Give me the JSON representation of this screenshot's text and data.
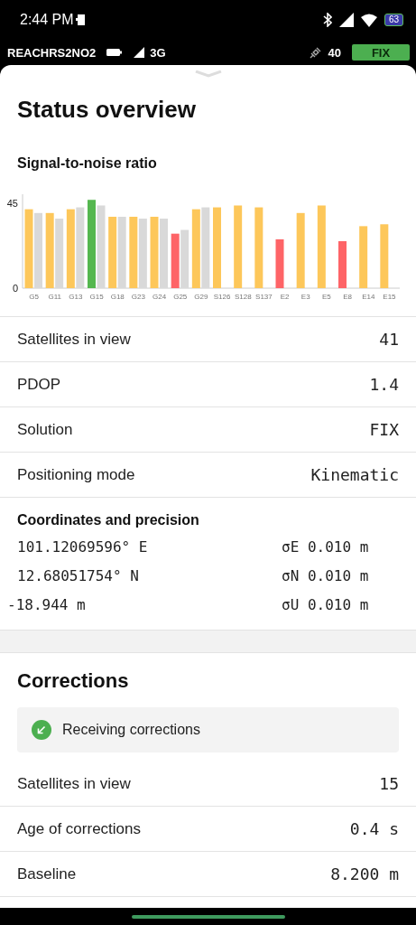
{
  "status_bar": {
    "time": "2:44 PM",
    "battery": "63"
  },
  "device_bar": {
    "name": "REACHRS2NO2",
    "network": "3G",
    "satellites": "40",
    "solution": "FIX"
  },
  "status_overview": {
    "title": "Status overview",
    "snr": {
      "title": "Signal-to-noise ratio",
      "chart_data": {
        "type": "bar",
        "categories": [
          "G5",
          "G11",
          "G13",
          "G15",
          "G18",
          "G23",
          "G24",
          "G25",
          "G29",
          "S126",
          "S128",
          "S137",
          "E2",
          "E3",
          "E5",
          "E8",
          "E14",
          "E15"
        ],
        "ylim": [
          0,
          50
        ],
        "yticks": [
          0,
          45
        ],
        "series": [
          {
            "colors": [
              "#fdc75a",
              "#fdc75a",
              "#fdc75a",
              "#55b74f",
              "#fdc75a",
              "#fdc75a",
              "#fdc75a",
              "#fe6467",
              "#fdc75a",
              "#fdc75a",
              "#fdc75a",
              "#fdc75a",
              "#fe6467",
              "#fdc75a",
              "#fdc75a",
              "#fe6467",
              "#fdc75a",
              "#fdc75a"
            ],
            "values": [
              42,
              40,
              42,
              47,
              38,
              38,
              38,
              29,
              42,
              43,
              44,
              43,
              26,
              40,
              44,
              25,
              33,
              34
            ]
          },
          {
            "color": "#d9d9d9",
            "values": [
              40,
              37,
              43,
              44,
              38,
              37,
              37,
              31,
              43,
              null,
              null,
              null,
              null,
              null,
              null,
              null,
              null,
              null
            ]
          }
        ]
      }
    },
    "rows": [
      {
        "label": "Satellites in view",
        "value": "41"
      },
      {
        "label": "PDOP",
        "value": "1.4"
      },
      {
        "label": "Solution",
        "value": "FIX"
      },
      {
        "label": "Positioning mode",
        "value": "Kinematic"
      }
    ],
    "coordinates": {
      "title": "Coordinates and precision",
      "lines": [
        {
          "value": "101.12069596° E",
          "precision": "σE 0.010 m"
        },
        {
          "value": "12.68051754° N",
          "precision": "σN 0.010 m"
        },
        {
          "value": "-18.944 m",
          "precision": "σU 0.010 m"
        }
      ]
    }
  },
  "corrections": {
    "title": "Corrections",
    "status": "Receiving corrections",
    "rows": [
      {
        "label": "Satellites in view",
        "value": "15"
      },
      {
        "label": "Age of corrections",
        "value": "0.4 s"
      },
      {
        "label": "Baseline",
        "value": "8.200 m"
      }
    ]
  }
}
